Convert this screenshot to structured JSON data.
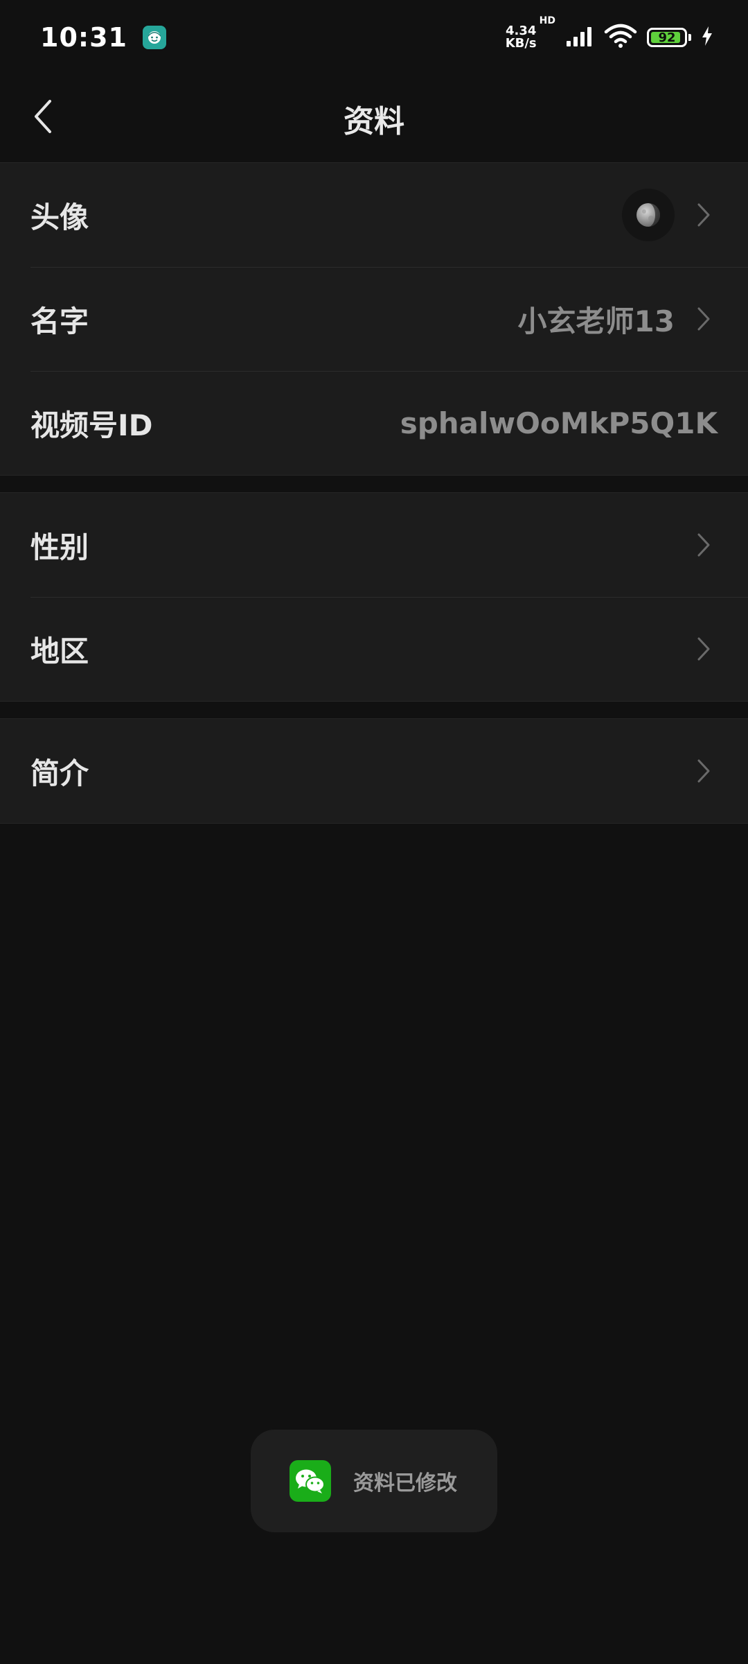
{
  "status_bar": {
    "time": "10:31",
    "net_speed_value": "4.34",
    "net_speed_unit": "KB/s",
    "network_type": "HD",
    "battery_level": "92",
    "battery_fraction": 0.92,
    "icons": [
      "app-badge-icon",
      "signal-icon",
      "wifi-icon",
      "battery-icon",
      "charging-icon"
    ],
    "colors": {
      "battery_fill": "#5fd03c",
      "app_badge": "#26a69a"
    }
  },
  "nav": {
    "title": "资料",
    "back_icon": "chevron-left-icon"
  },
  "profile_section": {
    "avatar_label": "头像",
    "name_label": "名字",
    "name_value": "小玄老师13",
    "channel_id_label": "视频号ID",
    "channel_id_value": "sphalwOoMkP5Q1K"
  },
  "info_section": {
    "gender_label": "性别",
    "region_label": "地区"
  },
  "bio_section": {
    "bio_label": "简介"
  },
  "toast": {
    "text": "资料已修改",
    "icon": "wechat-icon",
    "icon_color": "#1aad19"
  }
}
